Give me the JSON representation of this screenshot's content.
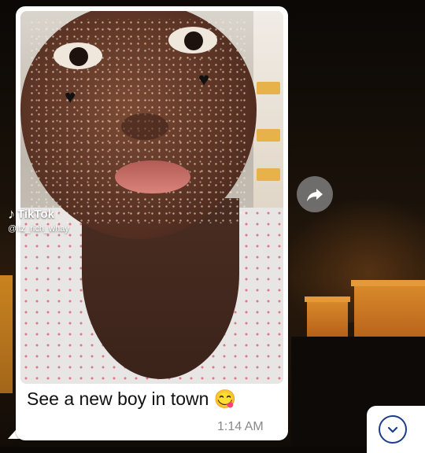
{
  "message": {
    "watermark_brand": "TikTok",
    "watermark_handle": "@itz_rich_whay",
    "caption": "See a new boy in town 😋",
    "time": "1:14 AM"
  },
  "icons": {
    "forward": "forward-arrow-icon",
    "scroll_down": "chevron-down-circle-icon",
    "tiktok": "tiktok-note-icon",
    "heart": "black-heart-icon"
  },
  "colors": {
    "bubble": "#ffffff",
    "accent": "#1c3d8e",
    "timestamp": "#8a8a8a"
  }
}
